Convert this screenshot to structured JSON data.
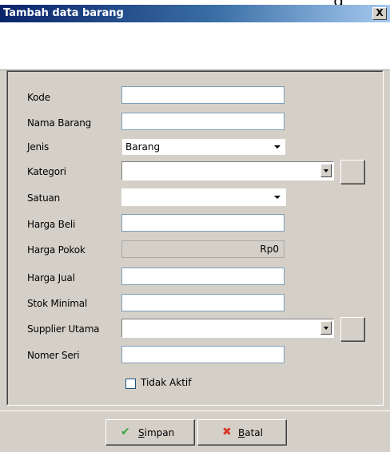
{
  "window": {
    "title": "Tambah data barang",
    "close_glyph": "X",
    "top_glyph": "g"
  },
  "form": {
    "kode_label": "Kode",
    "kode_value": "",
    "nama_label": "Nama Barang",
    "nama_value": "",
    "jenis_label": "Jenis",
    "jenis_value": "Barang",
    "kategori_label": "Kategori",
    "kategori_value": "",
    "satuan_label": "Satuan",
    "satuan_value": "",
    "harga_beli_label": "Harga Beli",
    "harga_beli_value": "",
    "harga_pokok_label": "Harga Pokok",
    "harga_pokok_value": "Rp0",
    "harga_jual_label": "Harga Jual",
    "harga_jual_value": "",
    "stok_label": "Stok Minimal",
    "stok_value": "",
    "supplier_label": "Supplier Utama",
    "supplier_value": "",
    "seri_label": "Nomer Seri",
    "seri_value": "",
    "tidak_aktif_label": "Tidak Aktif",
    "tidak_aktif_checked": false
  },
  "buttons": {
    "simpan_label": "Simpan",
    "simpan_hotkey": "S",
    "simpan_rest": "impan",
    "simpan_icon": "check-icon",
    "batal_label": "Batal",
    "batal_hotkey": "B",
    "batal_rest": "atal",
    "batal_icon": "cross-icon"
  },
  "colors": {
    "titlebar_start": "#0a246a",
    "titlebar_end": "#a6caf0",
    "dialog_bg": "#d4d0c8",
    "check_green": "#3aa63a",
    "cross_red": "#d83a2a"
  }
}
